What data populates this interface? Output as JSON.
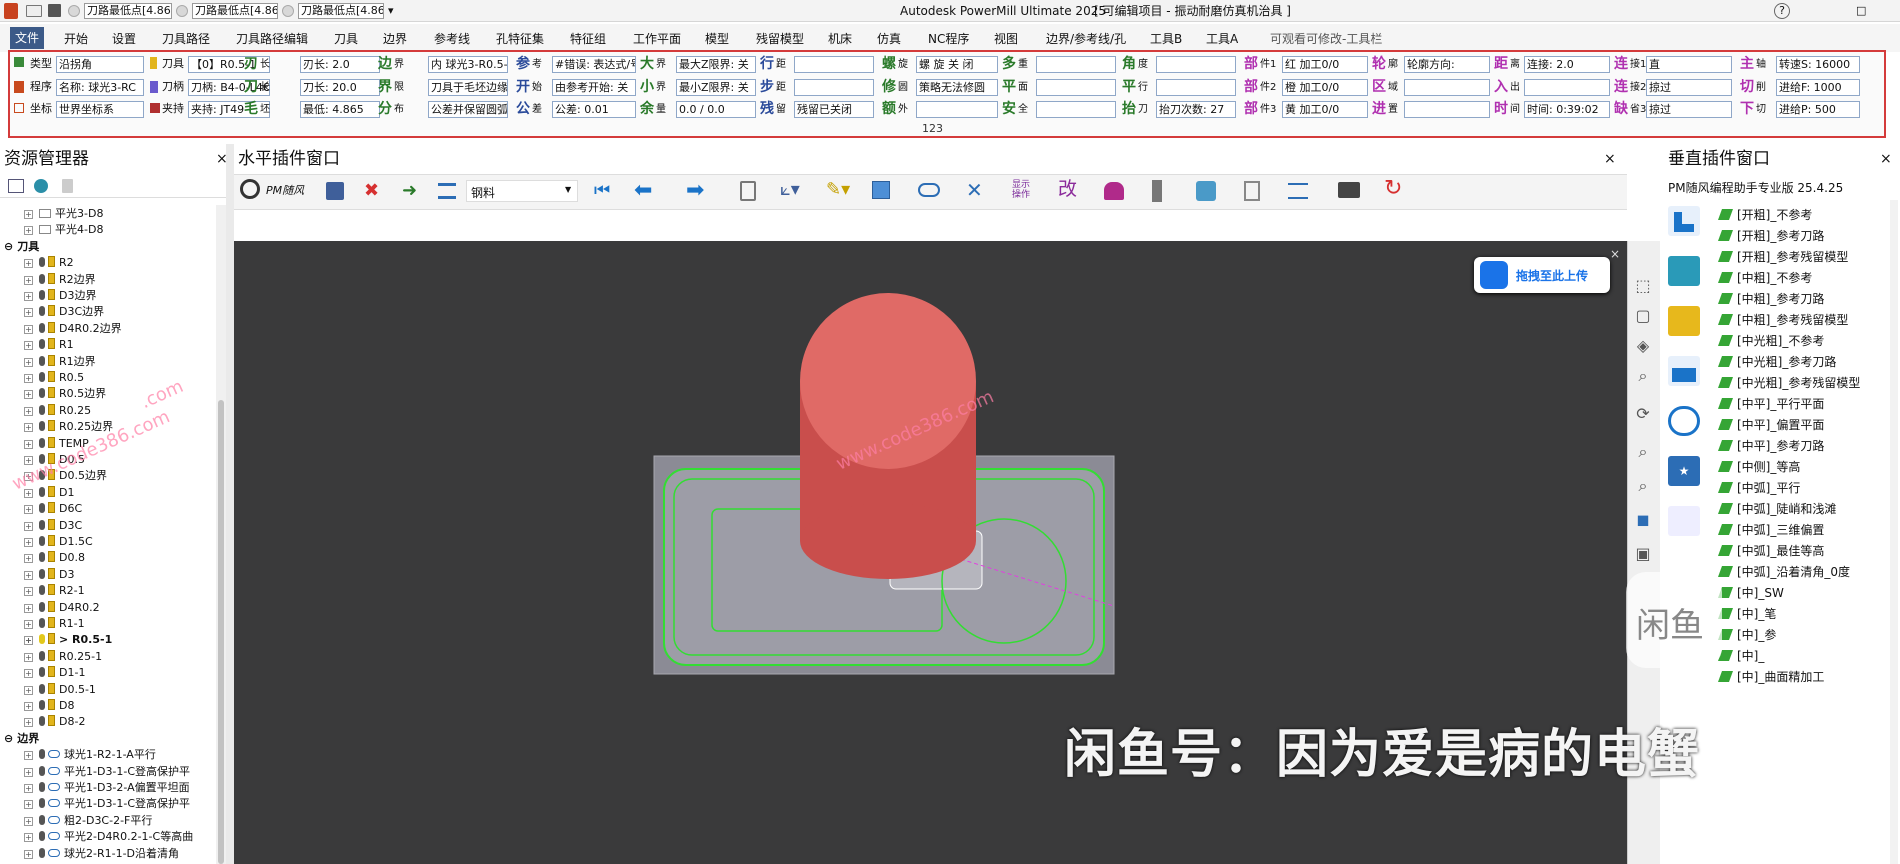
{
  "window": {
    "title": "Autodesk PowerMill Ultimate 2025",
    "subtitle": "[ 可编辑项目 - 振动耐磨仿真机治具 ]",
    "help": "?",
    "restore": "□"
  },
  "quick": {
    "box1": "刀路最低点[4.86",
    "box2": "刀路最低点[4.86",
    "box3": "刀路最低点[4.86",
    "arrow": "▾"
  },
  "tabs": [
    "文件",
    "开始",
    "设置",
    "刀具路径",
    "刀具路径编辑",
    "刀具",
    "边界",
    "参考线",
    "孔特征集",
    "特征组",
    "工作平面",
    "模型",
    "残留模型",
    "机床",
    "仿真",
    "NC程序",
    "视图",
    "边界/参考线/孔",
    "工具B",
    "工具A",
    "可观看可修改-工具栏"
  ],
  "ribbon": {
    "c1": {
      "l1": "类型",
      "v1": "沿拐角",
      "l2": "程序",
      "v2": "名称: 球光3-RC",
      "l3": "坐标",
      "v3": "世界坐标系"
    },
    "c2": {
      "l1": "刀具",
      "v1": "【0】R0.5-1",
      "l2": "刀柄",
      "v2": "刀柄: B4-0-L4€",
      "l3": "夹持",
      "v3": "夹持: JT49"
    },
    "c3": {
      "b1": "刃",
      "s1": "长",
      "v1": "刃长: 2.0",
      "b2": "刀",
      "s2": "长",
      "v2": "刀长: 20.0",
      "b3": "毛",
      "s3": "坯",
      "v3": "最低: 4.865"
    },
    "c4": {
      "b1": "边",
      "s1": "界",
      "v1": "内 球光3-R0.5-",
      "b2": "界",
      "s2": "限",
      "v2": "刀具于毛坯边缘",
      "b3": "分",
      "s3": "布",
      "v3": "公差并保留圆弧"
    },
    "c5": {
      "b1": "参",
      "s1": "考",
      "v1": "#错误: 表达式/号",
      "b2": "开",
      "s2": "始",
      "v2": "由参考开始: 关",
      "b3": "公",
      "s3": "差",
      "v3": "公差: 0.01"
    },
    "c6": {
      "b1": "大",
      "s1": "界",
      "v1": "最大Z限界: 关",
      "b2": "小",
      "s2": "界",
      "v2": "最小Z限界: 关",
      "b3": "余",
      "s3": "量",
      "v3": "0.0 / 0.0"
    },
    "c7": {
      "b1": "行",
      "s1": "距",
      "v1": "",
      "b2": "步",
      "s2": "距",
      "v2": "",
      "b3": "残",
      "s3": "留",
      "v3": "残留已关闭"
    },
    "c8": {
      "b1": "螺",
      "s1": "旋",
      "v1": "螺 旋 关 闭",
      "b2": "修",
      "s2": "圆",
      "v2": "策略无法修圆",
      "b3": "额",
      "s3": "外",
      "v3": ""
    },
    "c9": {
      "b1": "多",
      "s1": "重",
      "v1": "",
      "b2": "平",
      "s2": "面",
      "v2": "",
      "b3": "安",
      "s3": "全",
      "v3": ""
    },
    "c10": {
      "b1": "角",
      "s1": "度",
      "v1": "",
      "b2": "平",
      "s2": "行",
      "v2": "",
      "b3": "抬",
      "s3": "刀",
      "v3": "抬刀次数: 27"
    },
    "c11": {
      "b1": "部",
      "s1": "件1",
      "v1": "红 加工0/0",
      "b2": "部",
      "s2": "件2",
      "v2": "橙 加工0/0",
      "b3": "部",
      "s3": "件3",
      "v3": "黄 加工0/0"
    },
    "c12": {
      "b1": "轮",
      "s1": "廓",
      "v1": "轮廓方向:",
      "b2": "区",
      "s2": "域",
      "v2": "",
      "b3": "进",
      "s3": "置",
      "v3": ""
    },
    "c13": {
      "b1": "距",
      "s1": "离",
      "v1": "连接: 2.0",
      "b2": "入",
      "s2": "出",
      "v2": "",
      "b3": "时",
      "s3": "间",
      "v3": "时间: 0:39:02"
    },
    "c14": {
      "b1": "连",
      "s1": "接1",
      "v1": "直",
      "b2": "连",
      "s2": "接2",
      "v2": "掠过",
      "b3": "缺",
      "s3": "省3",
      "v3": "掠过"
    },
    "c15": {
      "b1": "主",
      "s1": "轴",
      "v1": "转速S: 16000",
      "b2": "切",
      "s2": "削",
      "v2": "进给F: 1000",
      "b3": "下",
      "s3": "切",
      "v3": "进给P: 500"
    },
    "footer": "123"
  },
  "explorer": {
    "title": "资源管理器",
    "close": "×",
    "items": [
      {
        "t": "平光3-D8",
        "k": "folder"
      },
      {
        "t": "平光4-D8",
        "k": "folder"
      },
      {
        "t": "刀具",
        "k": "section"
      },
      {
        "t": "R2",
        "k": "tool"
      },
      {
        "t": "R2边界",
        "k": "tool"
      },
      {
        "t": "D3边界",
        "k": "tool"
      },
      {
        "t": "D3C边界",
        "k": "tool"
      },
      {
        "t": "D4R0.2边界",
        "k": "tool"
      },
      {
        "t": "R1",
        "k": "tool"
      },
      {
        "t": "R1边界",
        "k": "tool"
      },
      {
        "t": "R0.5",
        "k": "tool"
      },
      {
        "t": "R0.5边界",
        "k": "tool"
      },
      {
        "t": "R0.25",
        "k": "tool"
      },
      {
        "t": "R0.25边界",
        "k": "tool"
      },
      {
        "t": "TEMP",
        "k": "tool"
      },
      {
        "t": "D0.5",
        "k": "tool"
      },
      {
        "t": "D0.5边界",
        "k": "tool"
      },
      {
        "t": "D1",
        "k": "tool"
      },
      {
        "t": "D6C",
        "k": "tool"
      },
      {
        "t": "D3C",
        "k": "tool"
      },
      {
        "t": "D1.5C",
        "k": "tool"
      },
      {
        "t": "D0.8",
        "k": "tool"
      },
      {
        "t": "D3",
        "k": "tool"
      },
      {
        "t": "R2-1",
        "k": "tool"
      },
      {
        "t": "D4R0.2",
        "k": "tool"
      },
      {
        "t": "R1-1",
        "k": "tool"
      },
      {
        "t": "> R0.5-1",
        "k": "active"
      },
      {
        "t": "R0.25-1",
        "k": "tool"
      },
      {
        "t": "D1-1",
        "k": "tool"
      },
      {
        "t": "D0.5-1",
        "k": "tool"
      },
      {
        "t": "D8",
        "k": "tool"
      },
      {
        "t": "D8-2",
        "k": "tool"
      },
      {
        "t": "边界",
        "k": "section"
      },
      {
        "t": "球光1-R2-1-A平行",
        "k": "b"
      },
      {
        "t": "平光1-D3-1-C登高保护平",
        "k": "b"
      },
      {
        "t": "平光1-D3-2-A偏置平坦面",
        "k": "b"
      },
      {
        "t": "平光1-D3-1-C登高保护平",
        "k": "b"
      },
      {
        "t": "粗2-D3C-2-F平行",
        "k": "b"
      },
      {
        "t": "平光2-D4R0.2-1-C等高曲",
        "k": "b"
      },
      {
        "t": "球光2-R1-1-D沿着清角",
        "k": "b"
      }
    ]
  },
  "hwin": {
    "title": "水平插件窗口",
    "close": "×",
    "brand": "PM随风",
    "material": "钢料",
    "menu1": "显示\n操作",
    "menu2": "改"
  },
  "vwin": {
    "title": "垂直插件窗口",
    "close": "×",
    "version": "PM随风编程助手专业版 25.4.25",
    "items": [
      "[开粗]_不参考",
      "[开粗]_参考刀路",
      "[开粗]_参考残留模型",
      "[中粗]_不参考",
      "[中粗]_参考刀路",
      "[中粗]_参考残留模型",
      "[中光粗]_不参考",
      "[中光粗]_参考刀路",
      "[中光粗]_参考残留模型",
      "[中平]_平行平面",
      "[中平]_偏置平面",
      "[中平]_参考刀路",
      "[中侧]_等高",
      "[中弧]_平行",
      "[中弧]_陡峭和浅滩",
      "[中弧]_三维偏置",
      "[中弧]_最佳等高",
      "[中弧]_沿着清角_0度",
      "[中]_SW",
      "[中]_笔",
      "[中]_参",
      "[中]_",
      "[中]_曲面精加工"
    ]
  },
  "upload": {
    "label": "拖拽至此上传"
  },
  "overlay": {
    "banner": "闲鱼号：因为爱是病的电蟹",
    "wm1": "www.code386.com",
    "wm2": "www.code386.com",
    "wm3": ".com",
    "logo": "闲鱼"
  },
  "colors": {
    "accent": "#3c5a88",
    "ribbonBorder": "#d43b3b",
    "viewport": "#3a3a3b",
    "cutter": "#e06a66",
    "toolpath": "#33dd33"
  }
}
